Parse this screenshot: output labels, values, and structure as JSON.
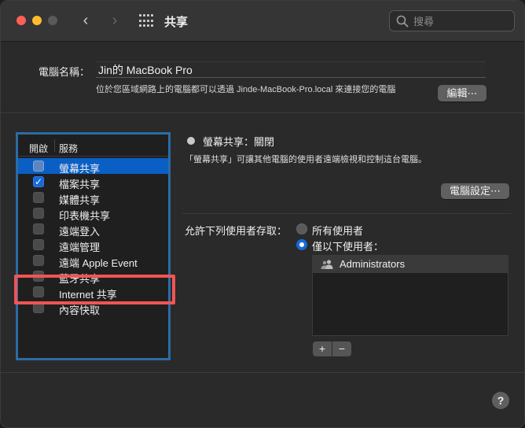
{
  "window": {
    "title": "共享",
    "search_placeholder": "搜尋",
    "nav_back": "‹",
    "nav_forward": "›"
  },
  "computer_name": {
    "label": "電腦名稱：",
    "value": "Jin的 MacBook Pro",
    "hint": "位於您區域網路上的電腦都可以透過 Jinde-MacBook-Pro.local 來連接您的電腦",
    "edit_button": "編輯⋯"
  },
  "services": {
    "header_on": "開啟",
    "header_service": "服務",
    "items": [
      {
        "label": "螢幕共享",
        "checked": false,
        "selected": true
      },
      {
        "label": "檔案共享",
        "checked": true,
        "selected": false
      },
      {
        "label": "媒體共享",
        "checked": false,
        "selected": false
      },
      {
        "label": "印表機共享",
        "checked": false,
        "selected": false
      },
      {
        "label": "遠端登入",
        "checked": false,
        "selected": false
      },
      {
        "label": "遠端管理",
        "checked": false,
        "selected": false
      },
      {
        "label": "遠端 Apple Event",
        "checked": false,
        "selected": false
      },
      {
        "label": "藍牙共享",
        "checked": false,
        "selected": false
      },
      {
        "label": "Internet 共享",
        "checked": false,
        "selected": false
      },
      {
        "label": "內容快取",
        "checked": false,
        "selected": false
      }
    ]
  },
  "detail": {
    "status": "螢幕共享：關閉",
    "description": "「螢幕共享」可讓其他電腦的使用者遠端檢視和控制這台電腦。",
    "computer_settings_button": "電腦設定⋯",
    "allow_label": "允許下列使用者存取：",
    "option_all": "所有使用者",
    "option_only": "僅以下使用者：",
    "selected_option": "only",
    "users": [
      "Administrators"
    ],
    "add_button": "+",
    "remove_button": "−"
  },
  "help_button": "?",
  "colors": {
    "accent": "#0a5fc5",
    "highlight_box": "#f25454",
    "list_border": "#2b6ca3"
  }
}
